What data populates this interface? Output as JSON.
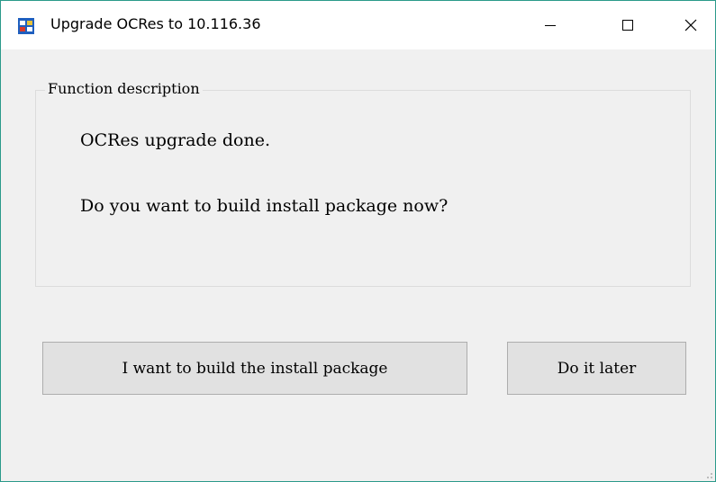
{
  "window": {
    "title": "Upgrade OCRes to 10.116.36",
    "controls": [
      "minimize-icon",
      "maximize-icon",
      "close-icon"
    ],
    "accent_border": "#2b9a8a"
  },
  "group": {
    "legend": "Function description",
    "line1": "OCRes upgrade done.",
    "line2": "Do you want to build install package now?"
  },
  "buttons": {
    "build_label": "I want to build the install package",
    "later_label": "Do it later"
  }
}
